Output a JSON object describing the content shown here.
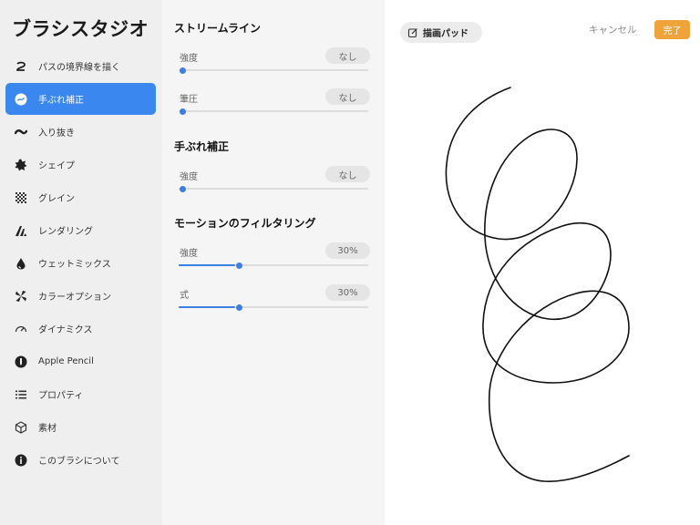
{
  "sidebar": {
    "title": "ブラシスタジオ",
    "active_index": 1,
    "items": [
      {
        "label": "パスの境界線を描く",
        "icon": "stroke-path-icon"
      },
      {
        "label": "手ぶれ補正",
        "icon": "stabilization-icon"
      },
      {
        "label": "入り抜き",
        "icon": "taper-icon"
      },
      {
        "label": "シェイプ",
        "icon": "shape-icon"
      },
      {
        "label": "グレイン",
        "icon": "grain-icon"
      },
      {
        "label": "レンダリング",
        "icon": "rendering-icon"
      },
      {
        "label": "ウェットミックス",
        "icon": "wet-mix-icon"
      },
      {
        "label": "カラーオプション",
        "icon": "color-dynamics-icon"
      },
      {
        "label": "ダイナミクス",
        "icon": "dynamics-icon"
      },
      {
        "label": "Apple Pencil",
        "icon": "apple-pencil-icon"
      },
      {
        "label": "プロパティ",
        "icon": "properties-icon"
      },
      {
        "label": "素材",
        "icon": "materials-icon"
      },
      {
        "label": "このブラシについて",
        "icon": "about-icon"
      }
    ]
  },
  "settings": {
    "sections": [
      {
        "title": "ストリームライン",
        "rows": [
          {
            "label": "強度",
            "value": "なし",
            "fraction": 0
          },
          {
            "label": "筆圧",
            "value": "なし",
            "fraction": 0
          }
        ]
      },
      {
        "title": "手ぶれ補正",
        "rows": [
          {
            "label": "強度",
            "value": "なし",
            "fraction": 0
          }
        ]
      },
      {
        "title": "モーションのフィルタリング",
        "rows": [
          {
            "label": "強度",
            "value": "30%",
            "fraction": 0.3
          },
          {
            "label": "式",
            "value": "30%",
            "fraction": 0.3
          }
        ]
      }
    ]
  },
  "canvas": {
    "pad_button_label": "描画パッド",
    "cancel_label": "キャンセル",
    "done_label": "完了",
    "stroke_color": "#111111"
  },
  "colors": {
    "accent": "#3b87f0",
    "done": "#f0a33a"
  }
}
